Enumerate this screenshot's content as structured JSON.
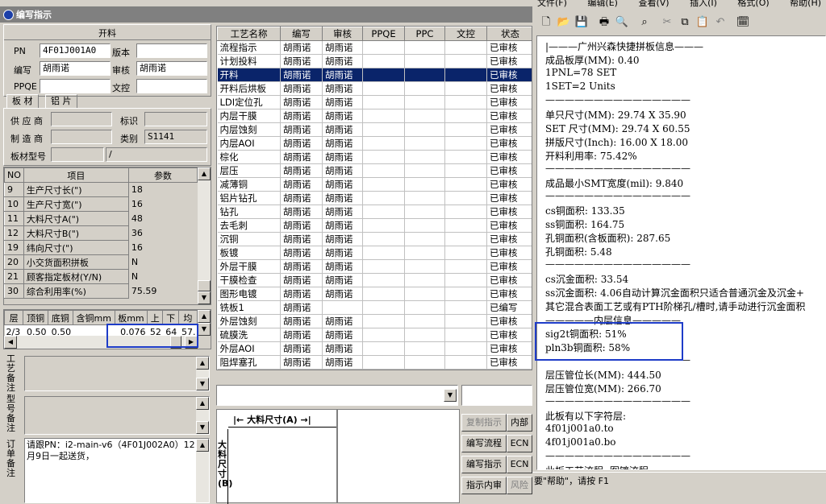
{
  "window_title": "编写指示",
  "kailiao": {
    "header": "开料",
    "pn_label": "PN",
    "pn_value": "4F01J001A0",
    "version_label": "版本",
    "version_value": "",
    "writer_label": "编写",
    "writer_value": "胡雨诺",
    "reviewer_label": "审核",
    "reviewer_value": "胡雨诺",
    "ppqe_label": "PPQE",
    "ppqe_value": "",
    "wenkong_label": "文控",
    "wenkong_value": ""
  },
  "material_tabs": [
    "板 材",
    "铝 片"
  ],
  "material": {
    "supplier_label": "供 应 商",
    "supplier_value": "",
    "mark_label": "标识",
    "mark_value": "",
    "maker_label": "制 造 商",
    "maker_value": "",
    "category_label": "类别",
    "category_value": "S1141",
    "model_label": "板材型号",
    "model_value": "",
    "model_value2": "/"
  },
  "param_table": {
    "headers": [
      "NO",
      "项目",
      "参数"
    ],
    "rows": [
      {
        "no": "9",
        "item": "生产尺寸长(\")",
        "value": "18"
      },
      {
        "no": "10",
        "item": "生产尺寸宽(\")",
        "value": "16"
      },
      {
        "no": "11",
        "item": "大料尺寸A(\")",
        "value": "48"
      },
      {
        "no": "12",
        "item": "大料尺寸B(\")",
        "value": "36"
      },
      {
        "no": "19",
        "item": "纬向尺寸(\")",
        "value": "16"
      },
      {
        "no": "20",
        "item": "小交货面积拼板",
        "value": "N"
      },
      {
        "no": "21",
        "item": "顾客指定板材(Y/N)",
        "value": "N"
      },
      {
        "no": "30",
        "item": "综合利用率(%)",
        "value": "75.59"
      }
    ]
  },
  "layer_table": {
    "headers": [
      "层",
      "顶铜",
      "底铜",
      "含铜mm",
      "板mm",
      "上",
      "下",
      "均"
    ],
    "row": [
      "2/3",
      "0.50",
      "0.50",
      "",
      "0.076",
      "52",
      "64",
      "57."
    ]
  },
  "notes": {
    "process_label": "工艺备注",
    "model_label": "型号备注",
    "order_label": "订单备注",
    "order_text": "请跟PN：i2-main-v6（4F01J002A0）12月9日一起送货，"
  },
  "process_table": {
    "headers": [
      "工艺名称",
      "编写",
      "审核",
      "PPQE",
      "PPC",
      "文控",
      "状态"
    ],
    "rows": [
      {
        "name": "流程指示",
        "writer": "胡雨诺",
        "reviewer": "胡雨诺",
        "status": "已审核",
        "selected": false
      },
      {
        "name": "计划投料",
        "writer": "胡雨诺",
        "reviewer": "胡雨诺",
        "status": "已审核",
        "selected": false
      },
      {
        "name": "开料",
        "writer": "胡雨诺",
        "reviewer": "胡雨诺",
        "status": "已审核",
        "selected": true
      },
      {
        "name": "开料后烘板",
        "writer": "胡雨诺",
        "reviewer": "胡雨诺",
        "status": "已审核",
        "selected": false
      },
      {
        "name": "LDI定位孔",
        "writer": "胡雨诺",
        "reviewer": "胡雨诺",
        "status": "已审核",
        "selected": false
      },
      {
        "name": "内层干膜",
        "writer": "胡雨诺",
        "reviewer": "胡雨诺",
        "status": "已审核",
        "selected": false
      },
      {
        "name": "内层蚀刻",
        "writer": "胡雨诺",
        "reviewer": "胡雨诺",
        "status": "已审核",
        "selected": false
      },
      {
        "name": "内层AOI",
        "writer": "胡雨诺",
        "reviewer": "胡雨诺",
        "status": "已审核",
        "selected": false
      },
      {
        "name": "棕化",
        "writer": "胡雨诺",
        "reviewer": "胡雨诺",
        "status": "已审核",
        "selected": false
      },
      {
        "name": "层压",
        "writer": "胡雨诺",
        "reviewer": "胡雨诺",
        "status": "已审核",
        "selected": false
      },
      {
        "name": "减薄铜",
        "writer": "胡雨诺",
        "reviewer": "胡雨诺",
        "status": "已审核",
        "selected": false
      },
      {
        "name": "铝片钻孔",
        "writer": "胡雨诺",
        "reviewer": "胡雨诺",
        "status": "已审核",
        "selected": false
      },
      {
        "name": "钻孔",
        "writer": "胡雨诺",
        "reviewer": "胡雨诺",
        "status": "已审核",
        "selected": false
      },
      {
        "name": "去毛刺",
        "writer": "胡雨诺",
        "reviewer": "胡雨诺",
        "status": "已审核",
        "selected": false
      },
      {
        "name": "沉铜",
        "writer": "胡雨诺",
        "reviewer": "胡雨诺",
        "status": "已审核",
        "selected": false
      },
      {
        "name": "板镀",
        "writer": "胡雨诺",
        "reviewer": "胡雨诺",
        "status": "已审核",
        "selected": false
      },
      {
        "name": "外层干膜",
        "writer": "胡雨诺",
        "reviewer": "胡雨诺",
        "status": "已审核",
        "selected": false
      },
      {
        "name": "干膜检查",
        "writer": "胡雨诺",
        "reviewer": "胡雨诺",
        "status": "已审核",
        "selected": false
      },
      {
        "name": "图形电镀",
        "writer": "胡雨诺",
        "reviewer": "胡雨诺",
        "status": "已审核",
        "selected": false
      },
      {
        "name": "铣板1",
        "writer": "胡雨诺",
        "reviewer": "",
        "status": "已编写",
        "selected": false
      },
      {
        "name": "外层蚀刻",
        "writer": "胡雨诺",
        "reviewer": "胡雨诺",
        "status": "已审核",
        "selected": false
      },
      {
        "name": "硫膜洗",
        "writer": "胡雨诺",
        "reviewer": "胡雨诺",
        "status": "已审核",
        "selected": false
      },
      {
        "name": "外层AOI",
        "writer": "胡雨诺",
        "reviewer": "胡雨诺",
        "status": "已审核",
        "selected": false
      },
      {
        "name": "阻焊塞孔",
        "writer": "胡雨诺",
        "reviewer": "胡雨诺",
        "status": "已审核",
        "selected": false
      }
    ]
  },
  "drawing": {
    "a_label": "大料尺寸(A)",
    "b_label": "大料尺寸(B)"
  },
  "buttons": {
    "copy": "复制指示",
    "edit_flow": "编写流程",
    "edit_instr": "编写指示",
    "instr_inner": "指示内审",
    "inner": "内部",
    "ecn1": "ECN",
    "ecn2": "ECN",
    "risk": "风险"
  },
  "notepad": {
    "menu": [
      "文件(F)",
      "编辑(E)",
      "查看(V)",
      "插入(I)",
      "格式(O)",
      "帮助(H)"
    ],
    "status_text": "要\"帮助\"，请按 F1",
    "lines": [
      "|———广州兴森快捷拼板信息———",
      "成品板厚(MM): 0.40",
      "1PNL=78 SET",
      "1SET=2 Units",
      "———————————————",
      "单只尺寸(MM): 29.74 X 35.90",
      "SET 尺寸(MM): 29.74 X 60.55",
      "拼版尺寸(Inch): 16.00 X 18.00",
      "开料利用率: 75.42%",
      "———————————————",
      "成品最小SMT宽度(mil): 9.840",
      "———————————————",
      "cs铜面积: 133.35",
      "ss铜面积: 164.75",
      "孔铜面积(含板面积): 287.65",
      "孔铜面积: 5.48",
      "———————————————",
      "cs沉金面积: 33.54",
      "ss沉金面积: 4.06自动计算沉金面积只适合普通沉金及沉金+",
      "其它混合表面工艺或有PTH阶梯孔/槽时,请手动进行沉金面积",
      "—————内层信息—————",
      "sig2t铜面积: 51%",
      "pln3b铜面积: 58%",
      "———————————————",
      "层压管位长(MM): 444.50",
      "层压管位宽(MM): 266.70",
      "———————————————",
      "此板有以下字符层:",
      "4f01j001a0.to",
      "4f01j001a0.bo",
      "———————————————",
      "此板工艺流程: 图镀流程"
    ]
  }
}
